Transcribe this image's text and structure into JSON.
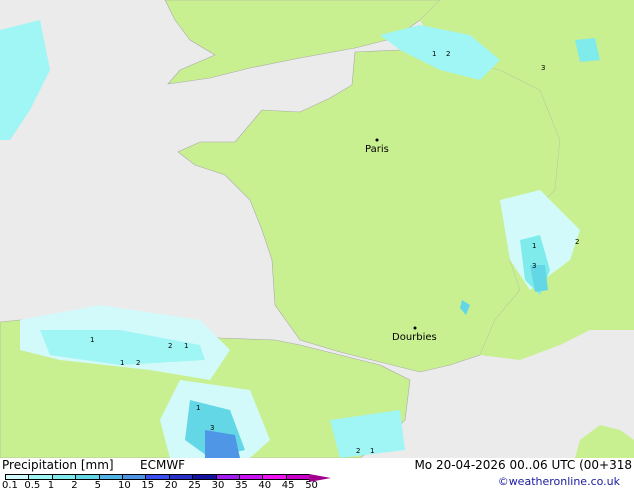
{
  "map": {
    "cities": [
      {
        "name": "Paris"
      },
      {
        "name": "Dourbies"
      }
    ],
    "cell_values": [
      "1",
      "2",
      "3",
      "1",
      "2",
      "3",
      "1",
      "2",
      "1",
      "1",
      "2",
      "1",
      "3",
      "2",
      "1"
    ]
  },
  "legend": {
    "title": "Precipitation [mm]",
    "model": "ECMWF",
    "datetime": "Mo 20-04-2026 00..06 UTC (00+318",
    "credit": "©weatheronline.co.uk",
    "ticks": [
      "0.1",
      "0.5",
      "1",
      "2",
      "5",
      "10",
      "15",
      "20",
      "25",
      "30",
      "35",
      "40",
      "45",
      "50"
    ],
    "colors": [
      "#d2fafa",
      "#a0f5f5",
      "#80ebeb",
      "#64d7e6",
      "#50b4e6",
      "#5096e6",
      "#3c50f0",
      "#2832c8",
      "#1414a0",
      "#a01ef0",
      "#c814f0",
      "#f014f0",
      "#c800c8",
      "#a0008c"
    ]
  }
}
